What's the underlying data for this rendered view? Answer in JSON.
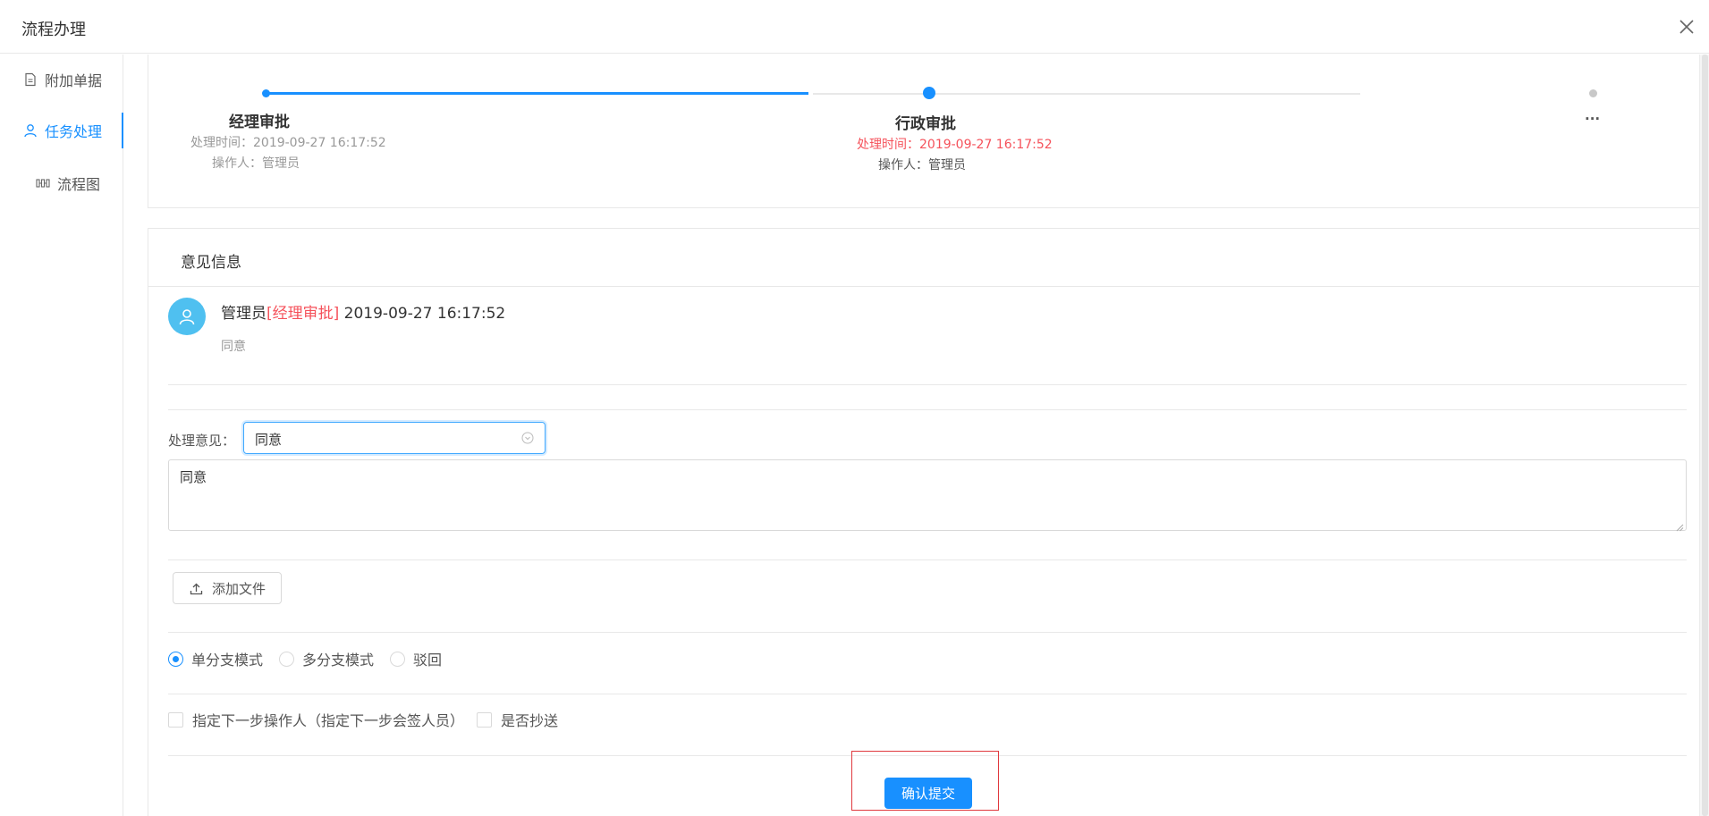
{
  "window": {
    "title": "流程办理"
  },
  "sidebar": {
    "items": [
      {
        "label": "附加单据",
        "icon": "document-icon",
        "active": false
      },
      {
        "label": "任务处理",
        "icon": "user-icon",
        "active": true
      },
      {
        "label": "流程图",
        "icon": "flow-chart-icon",
        "active": false
      }
    ]
  },
  "steps": [
    {
      "title": "经理审批",
      "time_label": "处理时间：",
      "time": "2019-09-27 16:17:52",
      "operator_label": "操作人：",
      "operator": "管理员",
      "status": "done"
    },
    {
      "title": "行政审批",
      "time_label": "处理时间：",
      "time": "2019-09-27 16:17:52",
      "operator_label": "操作人：",
      "operator": "管理员",
      "status": "current"
    },
    {
      "title": "...",
      "status": "pending"
    }
  ],
  "opinion": {
    "section_title": "意见信息",
    "comment": {
      "user": "管理员",
      "step_tag": "[经理审批]",
      "time": "2019-09-27 16:17:52",
      "text": "同意"
    }
  },
  "form": {
    "opinion_label": "处理意见：",
    "opinion_select_value": "同意",
    "opinion_text": "同意",
    "upload_label": "添加文件",
    "mode_options": [
      {
        "label": "单分支模式",
        "checked": true
      },
      {
        "label": "多分支模式",
        "checked": false
      },
      {
        "label": "驳回",
        "checked": false
      }
    ],
    "checkboxes": [
      {
        "label": "指定下一步操作人（指定下一步会签人员）",
        "checked": false
      },
      {
        "label": "是否抄送",
        "checked": false
      }
    ],
    "submit_label": "确认提交"
  },
  "colors": {
    "accent": "#1890ff",
    "danger": "#f5525b",
    "avatar": "#4fc0f0",
    "highlight_box": "#e0393e"
  }
}
